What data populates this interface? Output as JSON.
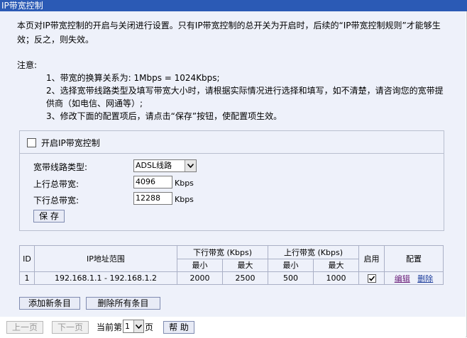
{
  "window": {
    "title": "IP带宽控制"
  },
  "description": "本页对IP带宽控制的开启与关闭进行设置。只有IP带宽控制的总开关为开启时，后续的“IP带宽控制规则”才能够生效；反之，则失效。",
  "notes": {
    "title": "注意:",
    "items": [
      "1、带宽的换算关系为: 1Mbps = 1024Kbps;",
      "2、选择宽带线路类型及填写带宽大小时，请根据实际情况进行选择和填写，如不清楚，请咨询您的宽带提供商（如电信、网通等）;",
      "3、修改下面的配置项后，请点击“保存”按钮，使配置项生效。"
    ]
  },
  "settings": {
    "enable_label": "开启IP带宽控制",
    "enable_checked": false,
    "line_type_label": "宽带线路类型:",
    "line_type_value": "ADSL线路",
    "up_label": "上行总带宽:",
    "up_value": "4096",
    "up_unit": "Kbps",
    "down_label": "下行总带宽:",
    "down_value": "12288",
    "down_unit": "Kbps",
    "save_label": "保 存"
  },
  "table": {
    "headers": {
      "id": "ID",
      "ip_range": "IP地址范围",
      "down_bw": "下行带宽 (Kbps)",
      "up_bw": "上行带宽 (Kbps)",
      "min": "最小",
      "max": "最大",
      "enable": "启用",
      "config": "配置"
    },
    "rows": [
      {
        "id": "1",
        "ip_range": "192.168.1.1 - 192.168.1.2",
        "down_min": "2000",
        "down_max": "2500",
        "up_min": "500",
        "up_max": "1000",
        "enabled": true,
        "edit": "编辑",
        "delete": "删除"
      }
    ]
  },
  "actions": {
    "add": "添加新条目",
    "delete_all": "删除所有条目"
  },
  "pager": {
    "prev": "上一页",
    "next": "下一页",
    "current_prefix": "当前第",
    "current_page": "1",
    "current_suffix": "页",
    "help": "帮 助"
  },
  "colors": {
    "titlebar": "#2b5ab5",
    "background": "#eef1fa",
    "border": "#aab0c6",
    "link": "#1c3d9c",
    "visited_link": "#6b1f7a"
  },
  "icons": {
    "dropdown": "chevron-down-icon",
    "checkmark": "check-icon"
  }
}
